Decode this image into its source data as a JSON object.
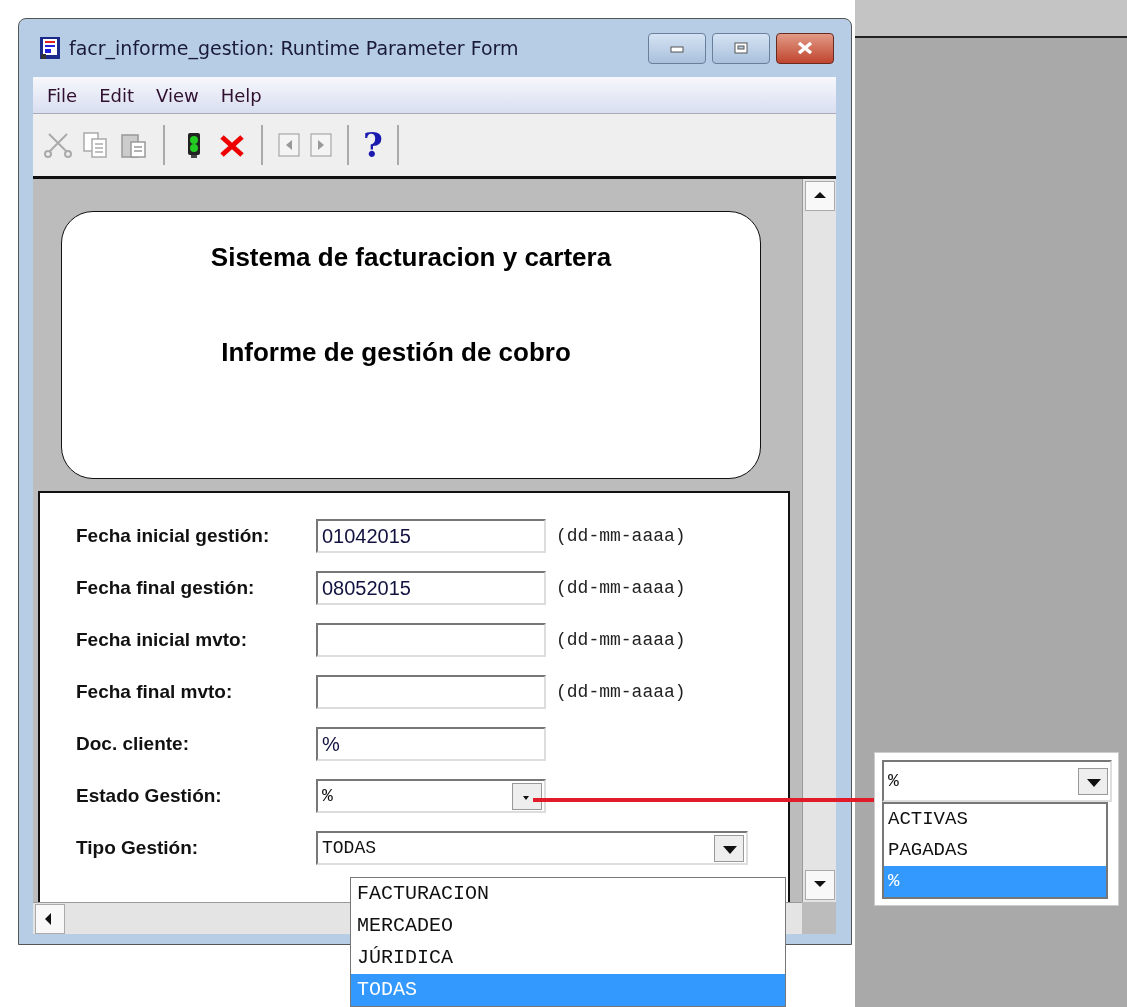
{
  "window": {
    "title": "facr_informe_gestion: Runtime Parameter Form"
  },
  "menu": [
    "File",
    "Edit",
    "View",
    "Help"
  ],
  "toolbar": [
    {
      "kind": "cut",
      "disabled": true
    },
    {
      "kind": "copy",
      "disabled": true
    },
    {
      "kind": "paste",
      "disabled": true
    },
    {
      "kind": "sep"
    },
    {
      "kind": "run",
      "disabled": false
    },
    {
      "kind": "cancel",
      "disabled": false
    },
    {
      "kind": "sep"
    },
    {
      "kind": "prev",
      "disabled": true
    },
    {
      "kind": "next",
      "disabled": true
    },
    {
      "kind": "sep"
    },
    {
      "kind": "help",
      "disabled": false,
      "glyph": "?"
    }
  ],
  "header": {
    "title": "Sistema de facturacion y cartera",
    "subtitle": "Informe de gestión de cobro"
  },
  "fields": [
    {
      "label": "Fecha inicial gestión:",
      "kind": "text",
      "value": "01042015",
      "hint": "(dd-mm-aaaa)"
    },
    {
      "label": "Fecha final gestión:",
      "kind": "text",
      "value": "08052015",
      "hint": "(dd-mm-aaaa)"
    },
    {
      "label": "Fecha inicial mvto:",
      "kind": "text",
      "hint": "(dd-mm-aaaa)"
    },
    {
      "label": "Fecha final mvto:",
      "kind": "text",
      "hint": "(dd-mm-aaaa)"
    },
    {
      "label": "Doc. cliente:",
      "kind": "text",
      "value": "%"
    },
    {
      "label": "Estado Gestión:",
      "kind": "combo",
      "value": "%"
    },
    {
      "label": "Tipo Gestión:",
      "kind": "wide-combo",
      "value": "TODAS"
    }
  ],
  "tipo_list": [
    {
      "label": "FACTURACION",
      "selected": false
    },
    {
      "label": "MERCADEO",
      "selected": false
    },
    {
      "label": "JÚRIDICA",
      "selected": false
    },
    {
      "label": "TODAS",
      "selected": true
    }
  ],
  "callout": {
    "value": "%",
    "options": [
      {
        "label": "ACTIVAS",
        "selected": false
      },
      {
        "label": "PAGADAS",
        "selected": false
      },
      {
        "label": "%",
        "selected": true
      }
    ]
  }
}
